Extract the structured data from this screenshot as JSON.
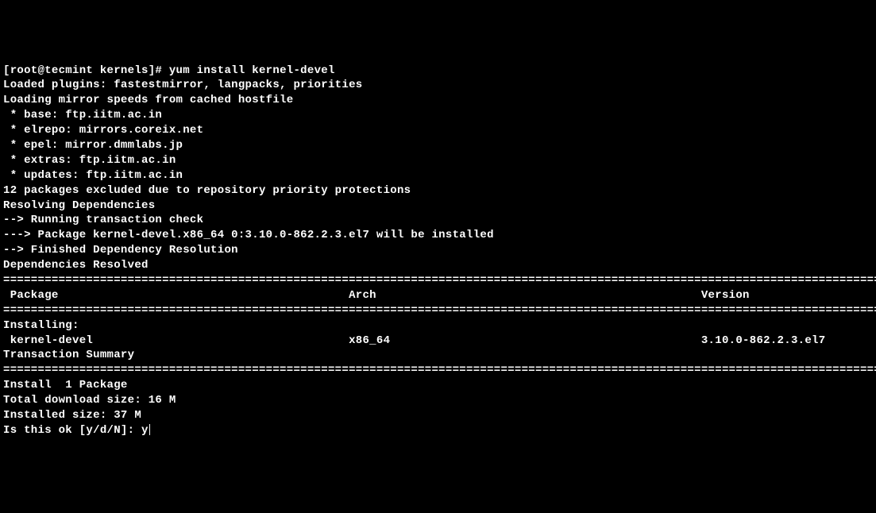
{
  "terminal": {
    "prompt_user": "[root@tecmint kernels]# ",
    "command": "yum install kernel-devel",
    "line1": "Loaded plugins: fastestmirror, langpacks, priorities",
    "line2": "Loading mirror speeds from cached hostfile",
    "line3": " * base: ftp.iitm.ac.in",
    "line4": " * elrepo: mirrors.coreix.net",
    "line5": " * epel: mirror.dmmlabs.jp",
    "line6": " * extras: ftp.iitm.ac.in",
    "line7": " * updates: ftp.iitm.ac.in",
    "line8": "12 packages excluded due to repository priority protections",
    "line9": "Resolving Dependencies",
    "line10": "--> Running transaction check",
    "line11": "---> Package kernel-devel.x86_64 0:3.10.0-862.2.3.el7 will be installed",
    "line12": "--> Finished Dependency Resolution",
    "line13": "",
    "line14": "Dependencies Resolved",
    "line15": "",
    "separator": "============================================================================================================================================",
    "table_header": " Package                                          Arch                                               Version",
    "line16": "Installing:",
    "table_row": " kernel-devel                                     x86_64                                             3.10.0-862.2.3.el7",
    "line17": "",
    "line18": "Transaction Summary",
    "line19": "Install  1 Package",
    "line20": "",
    "line21": "Total download size: 16 M",
    "line22": "Installed size: 37 M",
    "confirm_prompt": "Is this ok [y/d/N]: ",
    "confirm_input": "y"
  }
}
